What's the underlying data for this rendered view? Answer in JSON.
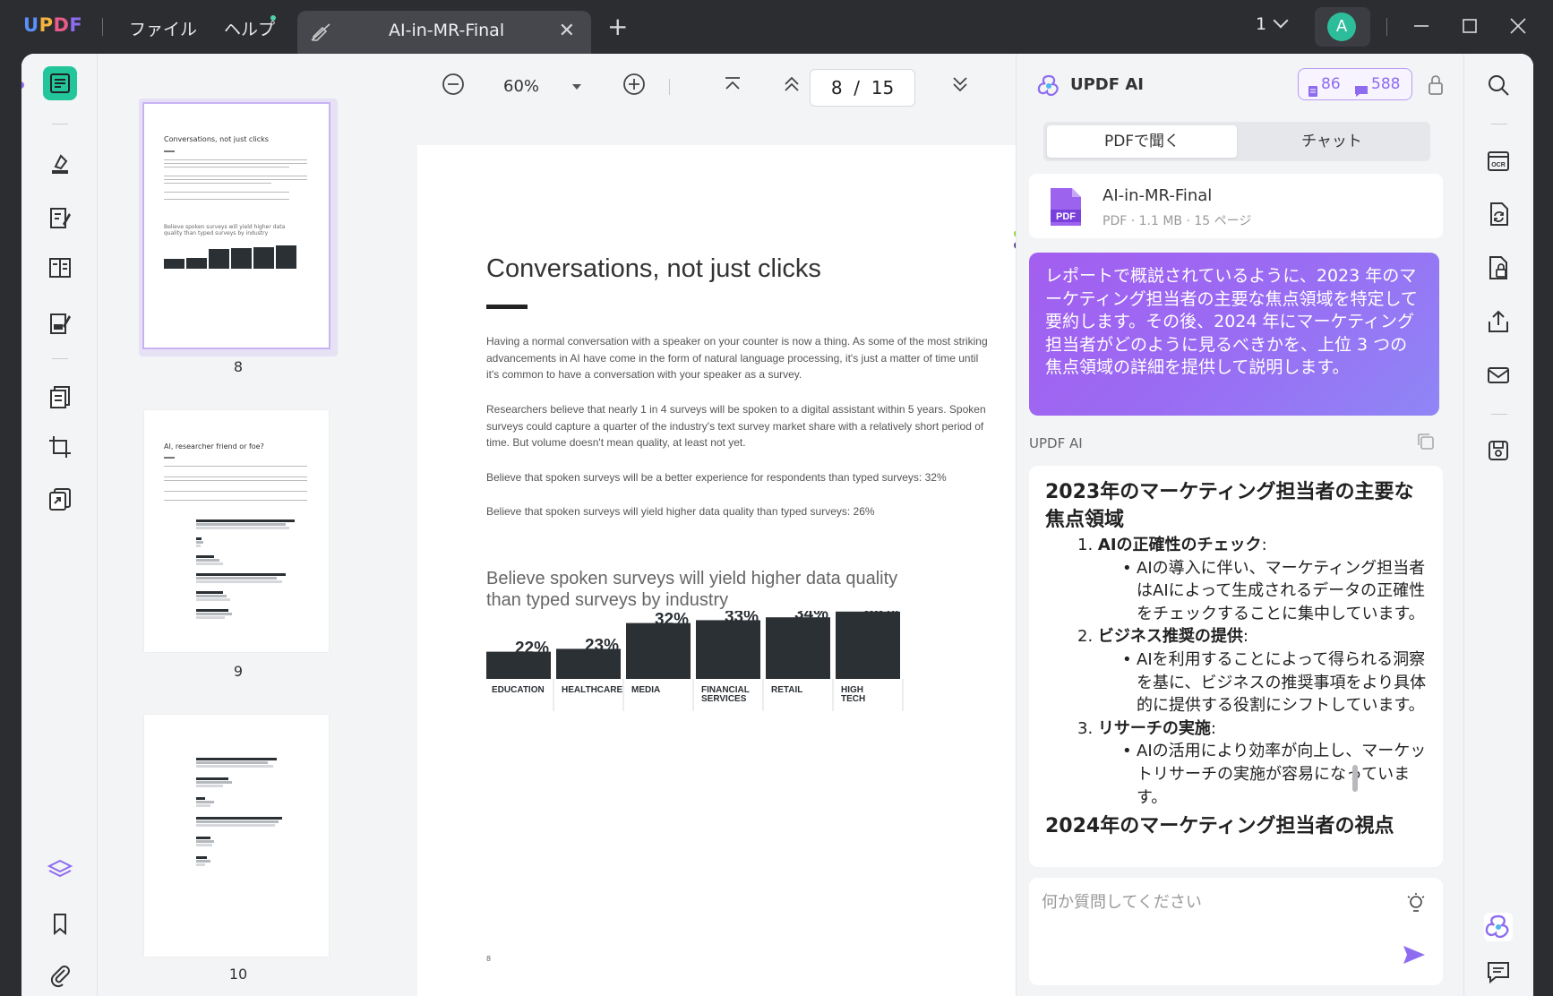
{
  "app": {
    "logo": "UPDF"
  },
  "menu": {
    "file": "ファイル",
    "help": "ヘルプ"
  },
  "tab": {
    "title": "AI-in-MR-Final"
  },
  "titlebar": {
    "page_selector": "1",
    "avatar_letter": "A"
  },
  "thumbnails": {
    "items": [
      {
        "label": "8",
        "title": "Conversations, not just clicks",
        "chart_title": "Believe spoken surveys will yield higher data quality than typed surveys by industry"
      },
      {
        "label": "9",
        "title": "AI, researcher friend or foe?"
      },
      {
        "label": "10"
      }
    ]
  },
  "viewer": {
    "zoom": "60%",
    "current_page": "8",
    "page_separator": "/",
    "total_pages": "15"
  },
  "page": {
    "title": "Conversations, not just clicks",
    "paragraphs": [
      "Having a normal conversation with a speaker on your counter is now a thing. As some of the most striking advancements in AI have come in the form of natural language processing, it's just a matter of time until it's common to have a conversation with your speaker as a survey.",
      "Researchers believe that nearly 1 in 4 surveys will be spoken to a digital assistant within 5 years. Spoken surveys could capture a quarter of the industry's text survey market share with a relatively short period of time. But volume doesn't mean quality, at least not yet.",
      "Believe that spoken surveys will be a better experience for respondents than typed surveys: 32%",
      "Believe that spoken surveys will yield higher data quality than typed surveys: 26%"
    ],
    "chart_title": "Believe spoken surveys will yield higher data quality than typed surveys by industry",
    "footer_page": "8"
  },
  "chart_data": {
    "type": "bar",
    "title": "Believe spoken surveys will yield higher data quality than typed surveys by industry",
    "categories": [
      "EDUCATION",
      "HEALTHCARE",
      "MEDIA",
      "FINANCIAL SERVICES",
      "RETAIL",
      "HIGH TECH"
    ],
    "values": [
      22,
      23,
      32,
      33,
      34,
      36
    ],
    "value_labels": [
      "22%",
      "23%",
      "32%",
      "33%",
      "34%",
      "36%"
    ],
    "ylim": [
      0,
      40
    ],
    "color": "#2b3035"
  },
  "ai": {
    "title": "UPDF AI",
    "credits_docs": "86",
    "credits_chat": "588",
    "tabs": {
      "ask_pdf": "PDFで聞く",
      "chat": "チャット"
    },
    "file": {
      "name": "AI-in-MR-Final",
      "icon_label": "PDF",
      "meta": "PDF · 1.1 MB · 15 ページ"
    },
    "prompt": "レポートで概説されているように、2023 年のマーケティング担当者の主要な焦点領域を特定して要約します。その後、2024 年にマーケティング担当者がどのように見るべきかを、上位 3 つの焦点領域の詳細を提供して説明します。",
    "response_label": "UPDF AI",
    "response": {
      "heading": "2023年のマーケティング担当者の主要な焦点領域",
      "items": [
        {
          "num": "1.",
          "title": "AIの正確性のチェック",
          "bullet": "AIの導入に伴い、マーケティング担当者はAIによって生成されるデータの正確性をチェックすることに集中しています。"
        },
        {
          "num": "2.",
          "title": "ビジネス推奨の提供",
          "bullet": "AIを利用することによって得られる洞察を基に、ビジネスの推奨事項をより具体的に提供する役割にシフトしています。"
        },
        {
          "num": "3.",
          "title": "リサーチの実施",
          "bullet": "AIの活用により効率が向上し、マーケットリサーチの実施が容易になっています。"
        }
      ],
      "next_heading": "2024年のマーケティング担当者の視点"
    },
    "input_placeholder": "何か質問してください"
  },
  "colors": {
    "accent": "#22c69a",
    "ai_purple": "#8e6cf0",
    "prompt_start": "#a35ef0",
    "prompt_end": "#8f86f6"
  }
}
